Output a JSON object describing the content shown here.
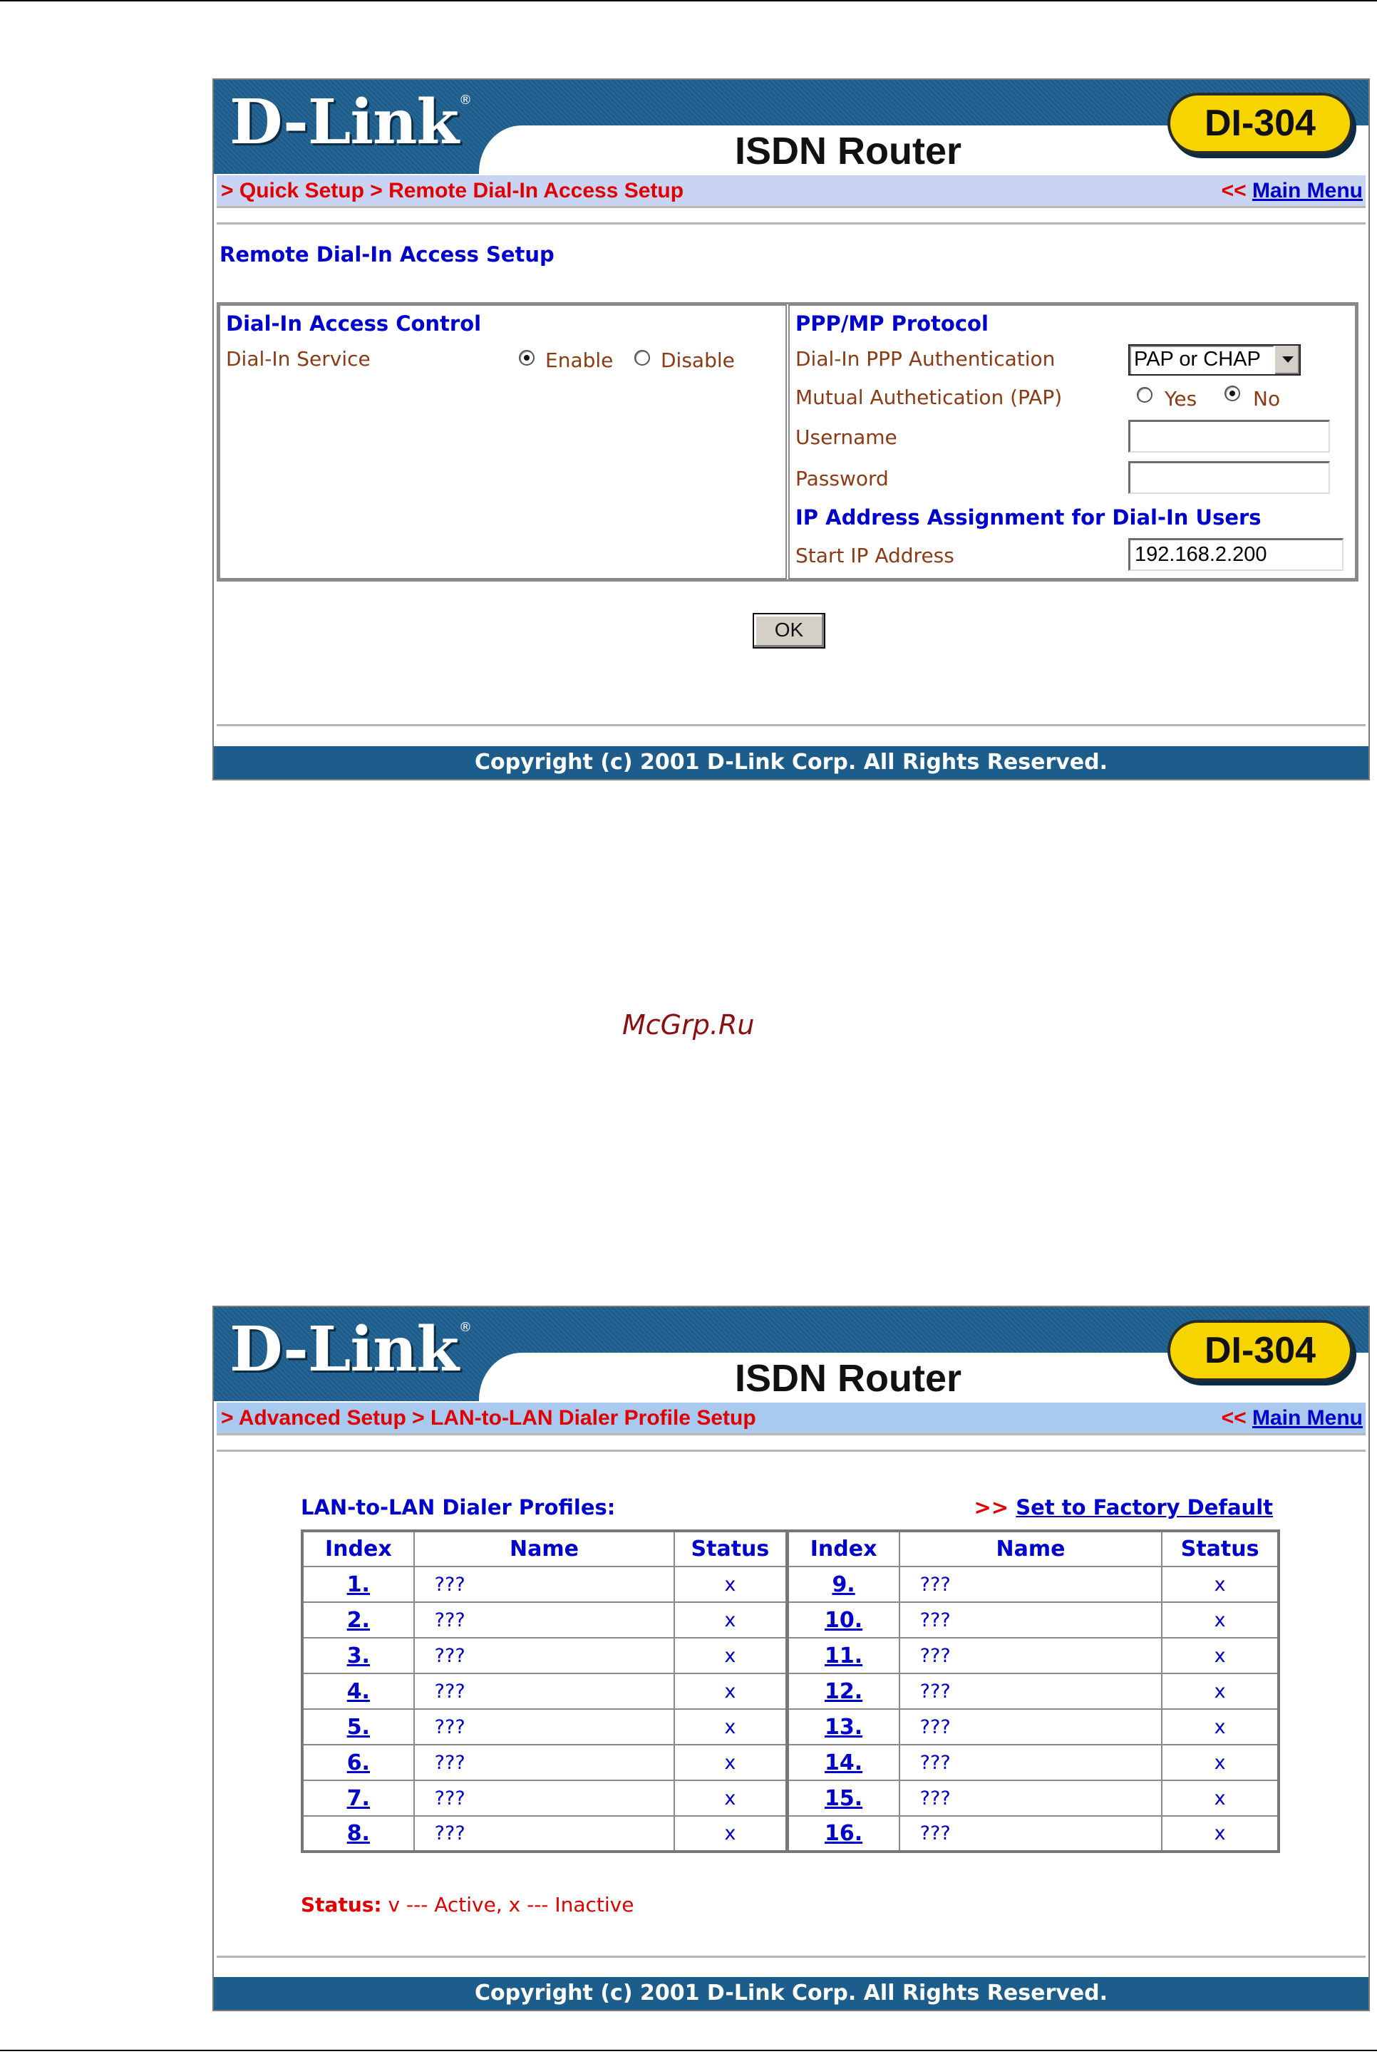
{
  "header": {
    "logo": "D-Link",
    "product": "ISDN Router",
    "model": "DI-304",
    "main_menu_arrows": "<<",
    "main_menu_label": "Main Menu"
  },
  "footer": {
    "copyright": "Copyright (c) 2001 D-Link Corp. All Rights Reserved."
  },
  "watermark": "McGrp.Ru",
  "dialin": {
    "breadcrumb": "> Quick Setup > Remote Dial-In Access Setup",
    "page_title": "Remote Dial-In Access Setup",
    "access_control": {
      "title": "Dial-In Access Control",
      "service_label": "Dial-In Service",
      "enable_label": "Enable",
      "disable_label": "Disable",
      "selected": "Enable"
    },
    "ppp": {
      "title": "PPP/MP Protocol",
      "auth_label": "Dial-In PPP Authentication",
      "auth_value": "PAP or CHAP",
      "mutual_label": "Mutual Authetication (PAP)",
      "yes_label": "Yes",
      "no_label": "No",
      "mutual_selected": "No",
      "username_label": "Username",
      "username_value": "",
      "password_label": "Password",
      "password_value": ""
    },
    "ip": {
      "title": "IP Address Assignment for Dial-In Users",
      "start_label": "Start IP Address",
      "start_value": "192.168.2.200"
    },
    "ok_label": "OK"
  },
  "dialer": {
    "breadcrumb": "> Advanced Setup > LAN-to-LAN Dialer Profile Setup",
    "list_title": "LAN-to-LAN Dialer Profiles:",
    "factory_arrows": ">>",
    "factory_label": "Set to Factory Default",
    "columns": [
      "Index",
      "Name",
      "Status",
      "Index",
      "Name",
      "Status"
    ],
    "left": [
      {
        "index": "1.",
        "name": "???",
        "status": "x"
      },
      {
        "index": "2.",
        "name": "???",
        "status": "x"
      },
      {
        "index": "3.",
        "name": "???",
        "status": "x"
      },
      {
        "index": "4.",
        "name": "???",
        "status": "x"
      },
      {
        "index": "5.",
        "name": "???",
        "status": "x"
      },
      {
        "index": "6.",
        "name": "???",
        "status": "x"
      },
      {
        "index": "7.",
        "name": "???",
        "status": "x"
      },
      {
        "index": "8.",
        "name": "???",
        "status": "x"
      }
    ],
    "right": [
      {
        "index": "9.",
        "name": "???",
        "status": "x"
      },
      {
        "index": "10.",
        "name": "???",
        "status": "x"
      },
      {
        "index": "11.",
        "name": "???",
        "status": "x"
      },
      {
        "index": "12.",
        "name": "???",
        "status": "x"
      },
      {
        "index": "13.",
        "name": "???",
        "status": "x"
      },
      {
        "index": "14.",
        "name": "???",
        "status": "x"
      },
      {
        "index": "15.",
        "name": "???",
        "status": "x"
      },
      {
        "index": "16.",
        "name": "???",
        "status": "x"
      }
    ],
    "legend_key": "Status:",
    "legend_text": "v --- Active, x --- Inactive"
  }
}
